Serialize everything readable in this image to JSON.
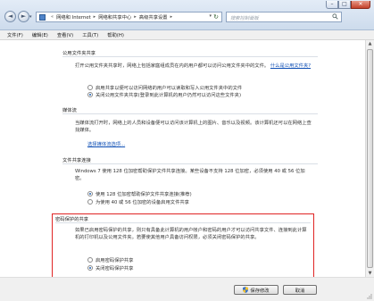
{
  "window": {
    "caption_min": "–",
    "caption_max": "□",
    "caption_close": "✕"
  },
  "nav": {
    "back_glyph": "◄",
    "forward_glyph": "►",
    "dropdown_glyph": "▾"
  },
  "address": {
    "prefix": "«",
    "crumbs": [
      "网络和 Internet",
      "网络和共享中心",
      "高级共享设置"
    ],
    "separator": "▸",
    "dropdown_glyph": "▾",
    "refresh_glyph": "↻"
  },
  "search": {
    "placeholder": "搜索控制面板"
  },
  "menu": {
    "items": [
      "文件(F)",
      "编辑(E)",
      "查看(V)",
      "工具(T)",
      "帮助(H)"
    ]
  },
  "public_folder": {
    "title": "公用文件夹共享",
    "desc": "打开公用文件夹共享时，网络上包括家庭组成员在内的用户都可以访问公用文件夹中的文件。",
    "link": "什么是公用文件夹?",
    "options": [
      {
        "label": "启用共享以便可以访问网络的用户可以读取和写入公用文件夹中的文件",
        "selected": false
      },
      {
        "label": "关闭公用文件夹共享(登录到此计算机的用户仍然可以访问这些文件夹)",
        "selected": true
      }
    ]
  },
  "media": {
    "title": "媒体流",
    "desc": "当媒体流打开时，网络上的人员和设备便可以访问该计算机上的图片、音乐以及视频。该计算机还可以在网络上查找媒体。",
    "link": "选择媒体流选项..."
  },
  "file_sharing": {
    "title": "文件共享连接",
    "desc": "Windows 7 使用 128 位加密帮助保护文件共享连接。某些设备不支持 128 位加密，必须使用 40 或 56 位加密。",
    "options": [
      {
        "label": "使用 128 位加密帮助保护文件共享连接(推荐)",
        "selected": true
      },
      {
        "label": "为使用 40 或 56 位加密的设备启用文件共享",
        "selected": false
      }
    ]
  },
  "password": {
    "title": "密码保护的共享",
    "desc": "如果已启用密码保护的共享，则只有具备此计算机的用户帐户和密码的用户才可以访问共享文件、连接到此计算机的打印机以及公用文件夹。若要使其他用户具备访问权限，必须关闭密码保护的共享。",
    "options": [
      {
        "label": "启用密码保护共享",
        "selected": false
      },
      {
        "label": "关闭密码保护共享",
        "selected": true
      }
    ],
    "highlight_color": "#e02424"
  },
  "footer": {
    "save_label": "保存修改",
    "cancel_label": "取消"
  },
  "colors": {
    "link": "#0f4fb5",
    "highlight": "#e02424"
  }
}
